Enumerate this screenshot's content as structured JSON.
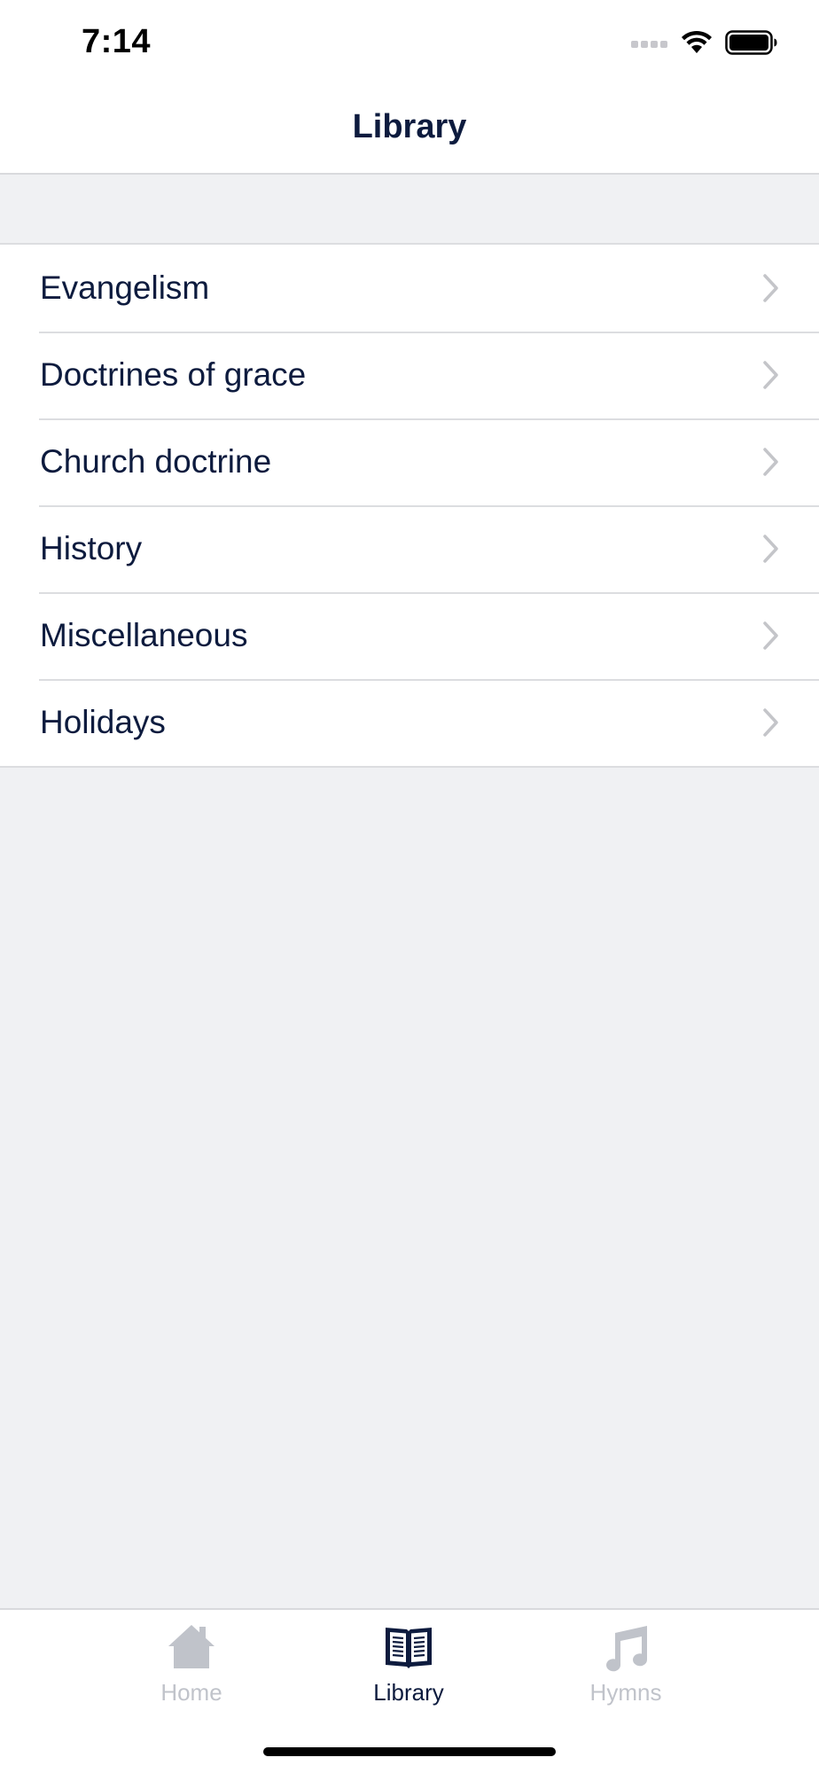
{
  "status_bar": {
    "time": "7:14"
  },
  "nav": {
    "title": "Library"
  },
  "library": {
    "items": [
      {
        "label": "Evangelism"
      },
      {
        "label": "Doctrines of grace"
      },
      {
        "label": "Church doctrine"
      },
      {
        "label": "History"
      },
      {
        "label": "Miscellaneous"
      },
      {
        "label": "Holidays"
      }
    ]
  },
  "tab_bar": {
    "tabs": [
      {
        "label": "Home",
        "icon": "home-icon",
        "active": false
      },
      {
        "label": "Library",
        "icon": "book-icon",
        "active": true
      },
      {
        "label": "Hymns",
        "icon": "music-note-icon",
        "active": false
      }
    ]
  },
  "colors": {
    "text_primary": "#0d1b3e",
    "tab_inactive": "#c0c3ca",
    "background": "#f0f1f3",
    "separator": "#dcdde0",
    "chevron": "#c4c5c9"
  }
}
